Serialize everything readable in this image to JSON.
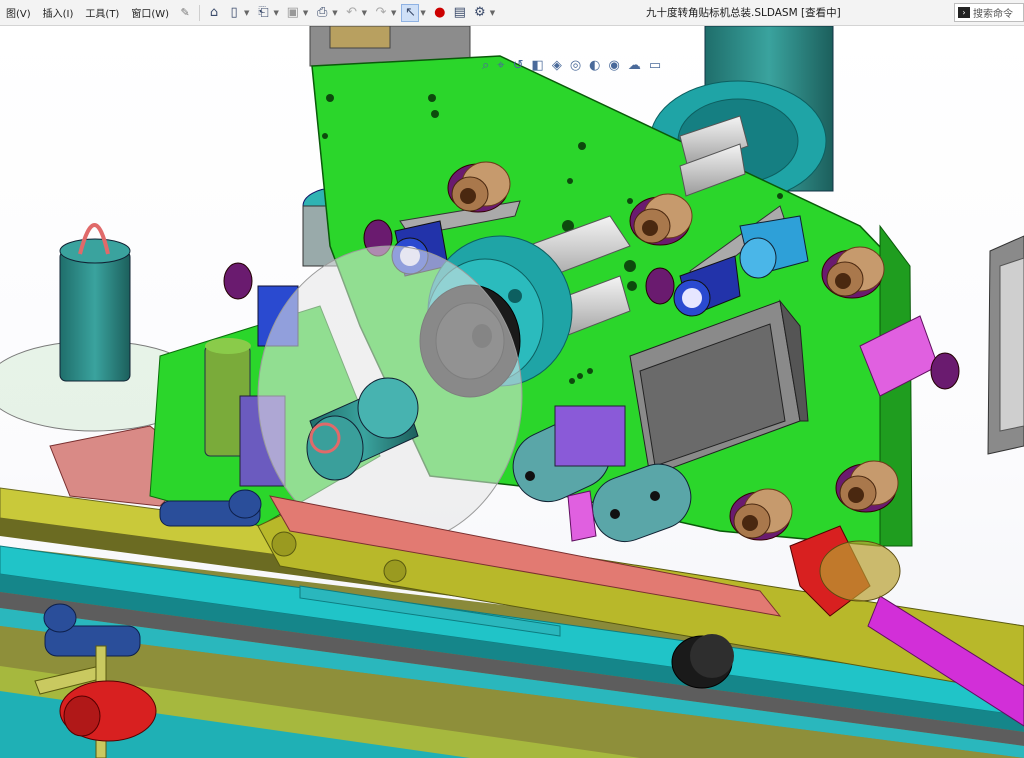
{
  "menubar": {
    "items": [
      {
        "label": "图(V)",
        "name": "menu-view"
      },
      {
        "label": "插入(I)",
        "name": "menu-insert"
      },
      {
        "label": "工具(T)",
        "name": "menu-tools"
      },
      {
        "label": "窗口(W)",
        "name": "menu-window"
      }
    ],
    "pin_icon": "pin-icon"
  },
  "toolbar": {
    "icons": [
      "home-icon",
      "new-document-icon",
      "open-icon",
      "save-icon",
      "print-icon",
      "undo-icon",
      "redo-icon",
      "select-pointer-icon",
      "traffic-light-icon",
      "file-properties-icon",
      "options-gear-icon"
    ]
  },
  "document": {
    "title": "九十度转角贴标机总装.SLDASM [查看中]"
  },
  "search": {
    "placeholder": "搜索命令"
  },
  "heads_up_toolbar": {
    "icons": [
      "zoom-to-fit-icon",
      "zoom-area-icon",
      "previous-view-icon",
      "section-view-icon",
      "view-orientation-icon",
      "display-style-icon",
      "hide-show-icon",
      "edit-appearance-icon",
      "apply-scene-icon",
      "view-settings-icon"
    ]
  },
  "colors": {
    "plate_green": "#2bd62b",
    "rail_yellow": "#b8b82a",
    "rail_cyan": "#22c4c8",
    "arm_salmon": "#e27a72",
    "magenta": "#d22fd8",
    "teal_motor": "#2f8a86",
    "bronze_roller": "#c69a6d",
    "purple_knob": "#6a1b6f",
    "navy_clamp": "#2a4e9a",
    "red_lever": "#d82020"
  }
}
